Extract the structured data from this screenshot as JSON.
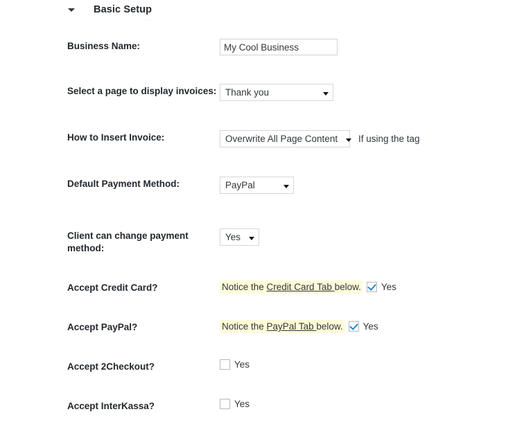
{
  "section": {
    "title": "Basic Setup",
    "toggle_icon": "chevron-down-icon",
    "expanded": true
  },
  "rows": {
    "business_name": {
      "label": "Business Name:",
      "value": "My Cool Business",
      "placeholder": ""
    },
    "display_page": {
      "label": "Select a page to display invoices:",
      "selected": "Thank you"
    },
    "insert_invoice": {
      "label": "How to Insert Invoice:",
      "selected": "Overwrite All Page Content",
      "helper": "If using the tag"
    },
    "default_payment": {
      "label": "Default Payment Method:",
      "selected": "PayPal"
    },
    "client_can_change": {
      "label": "Client can change payment method:",
      "selected": "Yes"
    },
    "credit_card": {
      "label": "Accept Credit Card?",
      "notice_prefix": "Notice the ",
      "notice_link": "Credit Card Tab ",
      "notice_suffix": "below.",
      "checkbox_label": "Yes",
      "checked": true
    },
    "paypal": {
      "label": "Accept PayPal?",
      "notice_prefix": "Notice the ",
      "notice_link": "PayPal Tab ",
      "notice_suffix": "below.",
      "checkbox_label": "Yes",
      "checked": true
    },
    "twocheckout": {
      "label": "Accept 2Checkout?",
      "checkbox_label": "Yes",
      "checked": false
    },
    "interkassa": {
      "label": "Accept InterKassa?",
      "checkbox_label": "Yes",
      "checked": false
    }
  },
  "colors": {
    "text": "#23282d",
    "notice_highlight": "#fffbd8",
    "checkbox_check": "#1e8cbe",
    "input_border": "#d3d3d3"
  }
}
